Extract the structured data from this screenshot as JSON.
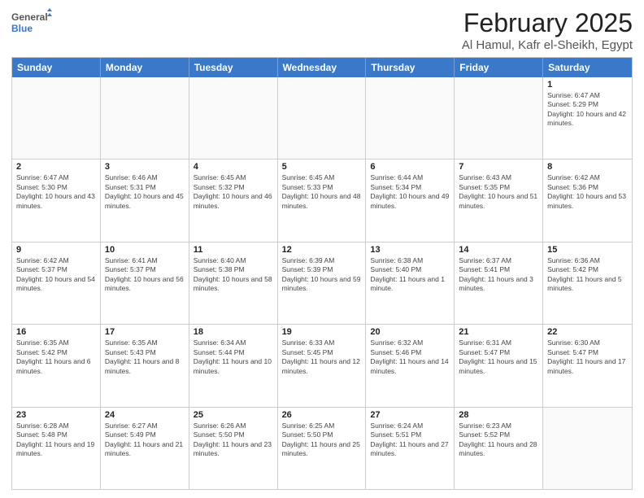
{
  "logo": {
    "line1": "General",
    "line2": "Blue"
  },
  "title": "February 2025",
  "subtitle": "Al Hamul, Kafr el-Sheikh, Egypt",
  "header_days": [
    "Sunday",
    "Monday",
    "Tuesday",
    "Wednesday",
    "Thursday",
    "Friday",
    "Saturday"
  ],
  "rows": [
    [
      {
        "day": "",
        "info": ""
      },
      {
        "day": "",
        "info": ""
      },
      {
        "day": "",
        "info": ""
      },
      {
        "day": "",
        "info": ""
      },
      {
        "day": "",
        "info": ""
      },
      {
        "day": "",
        "info": ""
      },
      {
        "day": "1",
        "info": "Sunrise: 6:47 AM\nSunset: 5:29 PM\nDaylight: 10 hours and 42 minutes."
      }
    ],
    [
      {
        "day": "2",
        "info": "Sunrise: 6:47 AM\nSunset: 5:30 PM\nDaylight: 10 hours and 43 minutes."
      },
      {
        "day": "3",
        "info": "Sunrise: 6:46 AM\nSunset: 5:31 PM\nDaylight: 10 hours and 45 minutes."
      },
      {
        "day": "4",
        "info": "Sunrise: 6:45 AM\nSunset: 5:32 PM\nDaylight: 10 hours and 46 minutes."
      },
      {
        "day": "5",
        "info": "Sunrise: 6:45 AM\nSunset: 5:33 PM\nDaylight: 10 hours and 48 minutes."
      },
      {
        "day": "6",
        "info": "Sunrise: 6:44 AM\nSunset: 5:34 PM\nDaylight: 10 hours and 49 minutes."
      },
      {
        "day": "7",
        "info": "Sunrise: 6:43 AM\nSunset: 5:35 PM\nDaylight: 10 hours and 51 minutes."
      },
      {
        "day": "8",
        "info": "Sunrise: 6:42 AM\nSunset: 5:36 PM\nDaylight: 10 hours and 53 minutes."
      }
    ],
    [
      {
        "day": "9",
        "info": "Sunrise: 6:42 AM\nSunset: 5:37 PM\nDaylight: 10 hours and 54 minutes."
      },
      {
        "day": "10",
        "info": "Sunrise: 6:41 AM\nSunset: 5:37 PM\nDaylight: 10 hours and 56 minutes."
      },
      {
        "day": "11",
        "info": "Sunrise: 6:40 AM\nSunset: 5:38 PM\nDaylight: 10 hours and 58 minutes."
      },
      {
        "day": "12",
        "info": "Sunrise: 6:39 AM\nSunset: 5:39 PM\nDaylight: 10 hours and 59 minutes."
      },
      {
        "day": "13",
        "info": "Sunrise: 6:38 AM\nSunset: 5:40 PM\nDaylight: 11 hours and 1 minute."
      },
      {
        "day": "14",
        "info": "Sunrise: 6:37 AM\nSunset: 5:41 PM\nDaylight: 11 hours and 3 minutes."
      },
      {
        "day": "15",
        "info": "Sunrise: 6:36 AM\nSunset: 5:42 PM\nDaylight: 11 hours and 5 minutes."
      }
    ],
    [
      {
        "day": "16",
        "info": "Sunrise: 6:35 AM\nSunset: 5:42 PM\nDaylight: 11 hours and 6 minutes."
      },
      {
        "day": "17",
        "info": "Sunrise: 6:35 AM\nSunset: 5:43 PM\nDaylight: 11 hours and 8 minutes."
      },
      {
        "day": "18",
        "info": "Sunrise: 6:34 AM\nSunset: 5:44 PM\nDaylight: 11 hours and 10 minutes."
      },
      {
        "day": "19",
        "info": "Sunrise: 6:33 AM\nSunset: 5:45 PM\nDaylight: 11 hours and 12 minutes."
      },
      {
        "day": "20",
        "info": "Sunrise: 6:32 AM\nSunset: 5:46 PM\nDaylight: 11 hours and 14 minutes."
      },
      {
        "day": "21",
        "info": "Sunrise: 6:31 AM\nSunset: 5:47 PM\nDaylight: 11 hours and 15 minutes."
      },
      {
        "day": "22",
        "info": "Sunrise: 6:30 AM\nSunset: 5:47 PM\nDaylight: 11 hours and 17 minutes."
      }
    ],
    [
      {
        "day": "23",
        "info": "Sunrise: 6:28 AM\nSunset: 5:48 PM\nDaylight: 11 hours and 19 minutes."
      },
      {
        "day": "24",
        "info": "Sunrise: 6:27 AM\nSunset: 5:49 PM\nDaylight: 11 hours and 21 minutes."
      },
      {
        "day": "25",
        "info": "Sunrise: 6:26 AM\nSunset: 5:50 PM\nDaylight: 11 hours and 23 minutes."
      },
      {
        "day": "26",
        "info": "Sunrise: 6:25 AM\nSunset: 5:50 PM\nDaylight: 11 hours and 25 minutes."
      },
      {
        "day": "27",
        "info": "Sunrise: 6:24 AM\nSunset: 5:51 PM\nDaylight: 11 hours and 27 minutes."
      },
      {
        "day": "28",
        "info": "Sunrise: 6:23 AM\nSunset: 5:52 PM\nDaylight: 11 hours and 28 minutes."
      },
      {
        "day": "",
        "info": ""
      }
    ]
  ]
}
